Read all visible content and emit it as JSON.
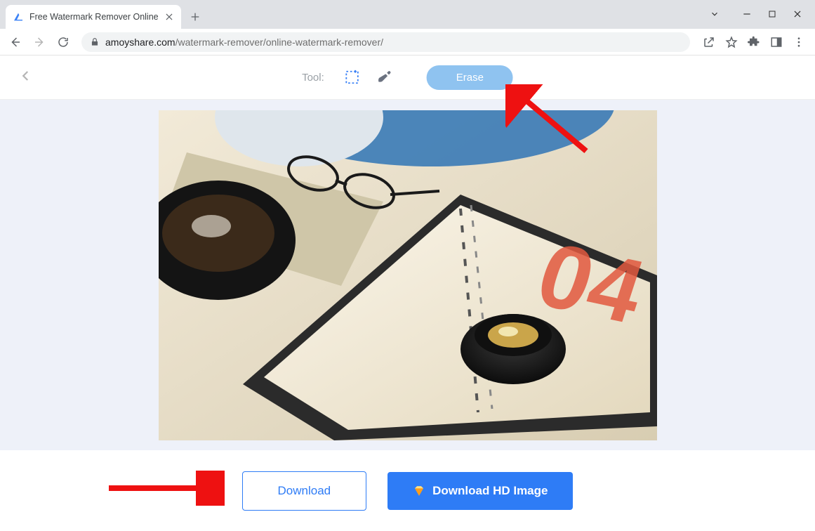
{
  "browser": {
    "tab_title": "Free Watermark Remover Online",
    "url_host": "amoyshare.com",
    "url_path": "/watermark-remover/online-watermark-remover/"
  },
  "toolbar": {
    "tool_label": "Tool:",
    "erase_label": "Erase"
  },
  "actions": {
    "download_label": "Download",
    "download_hd_label": "Download HD Image"
  },
  "image": {
    "big_number": "04"
  },
  "colors": {
    "primary": "#2e7cf6",
    "erase_btn": "#8fc3f0",
    "arrow": "#e11",
    "canvas_bg": "#eef1f9"
  }
}
